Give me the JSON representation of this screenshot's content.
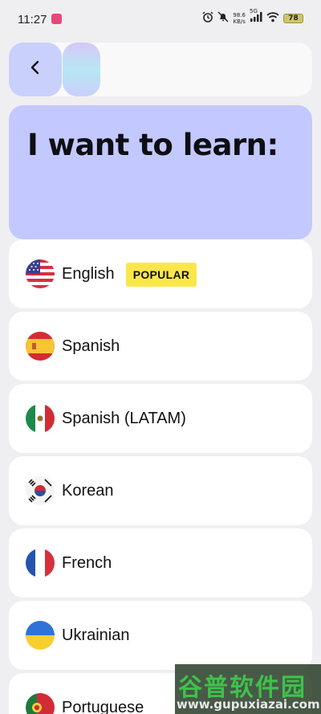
{
  "status_bar": {
    "time": "11:27",
    "network_speed_value": "98.6",
    "network_speed_unit": "KB/s",
    "signal_label": "5G",
    "battery": "78"
  },
  "header": {
    "back_icon": "chevron-left-icon",
    "progress_fraction": 0.15
  },
  "hero": {
    "title": "I want to learn:"
  },
  "languages": [
    {
      "name": "English",
      "flag": "us-flag-icon",
      "badge": "POPULAR"
    },
    {
      "name": "Spanish",
      "flag": "spain-flag-icon"
    },
    {
      "name": "Spanish (LATAM)",
      "flag": "mexico-flag-icon"
    },
    {
      "name": "Korean",
      "flag": "south-korea-flag-icon"
    },
    {
      "name": "French",
      "flag": "france-flag-icon"
    },
    {
      "name": "Ukrainian",
      "flag": "ukraine-flag-icon"
    },
    {
      "name": "Portuguese",
      "flag": "portugal-flag-icon"
    }
  ],
  "watermark": {
    "title": "谷普软件园",
    "url": "www.gupuxiazai.com"
  },
  "colors": {
    "background": "#efeff1",
    "accent": "#c3c9fe",
    "badge": "#fbe64a"
  }
}
